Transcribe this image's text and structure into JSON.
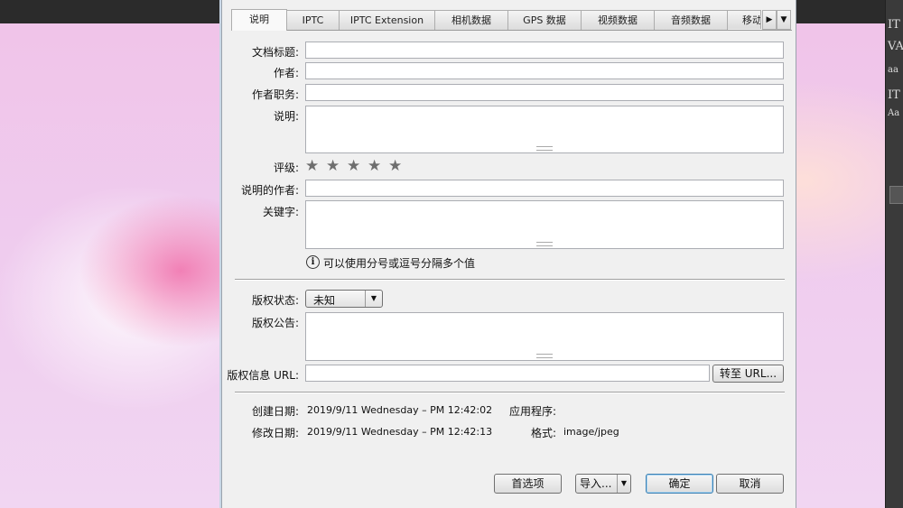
{
  "tabs": [
    "说明",
    "IPTC",
    "IPTC Extension",
    "相机数据",
    "GPS 数据",
    "视频数据",
    "音频数据",
    "移动"
  ],
  "tab_nav": {
    "next": "▶",
    "menu": "▼"
  },
  "fields": {
    "doc_title_label": "文档标题:",
    "author_label": "作者:",
    "author_title_label": "作者职务:",
    "description_label": "说明:",
    "rating_label": "评级:",
    "desc_writer_label": "说明的作者:",
    "keywords_label": "关键字:",
    "keywords_hint": "可以使用分号或逗号分隔多个值",
    "copyright_status_label": "版权状态:",
    "copyright_status_value": "未知",
    "copyright_notice_label": "版权公告:",
    "copyright_url_label": "版权信息 URL:",
    "goto_url_button": "转至 URL..."
  },
  "rating": {
    "stars": 5,
    "filled": 0
  },
  "meta": {
    "created_label": "创建日期:",
    "created_value": "2019/9/11 Wednesday – PM 12:42:02",
    "modified_label": "修改日期:",
    "modified_value": "2019/9/11 Wednesday – PM 12:42:13",
    "application_label": "应用程序:",
    "application_value": "",
    "format_label": "格式:",
    "format_value": "image/jpeg"
  },
  "buttons": {
    "preferences": "首选项",
    "import": "导入...",
    "ok": "确定",
    "cancel": "取消"
  },
  "right_panel_icons": [
    "IT",
    "VA",
    "aa",
    "IT",
    "Aa"
  ],
  "colors": {
    "accent": "#3c7fb1",
    "dialog_bg": "#f0f0f0",
    "canvas_pink": "#efcbee"
  }
}
